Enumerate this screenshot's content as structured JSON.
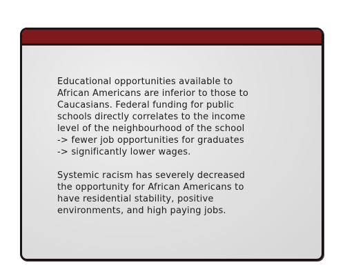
{
  "card": {
    "header_color": "#7e1a1d",
    "paragraphs": [
      "Educational opportunities available to\nAfrican Americans are inferior to those to\nCaucasians. Federal funding for public\nschools directly correlates to the income\nlevel of the neighbourhood of the school\n-> fewer job opportunities for graduates\n-> significantly lower wages.",
      "Systemic racism has severely decreased\nthe opportunity for African Americans to\nhave residential stability, positive\nenvironments, and high paying jobs."
    ]
  }
}
